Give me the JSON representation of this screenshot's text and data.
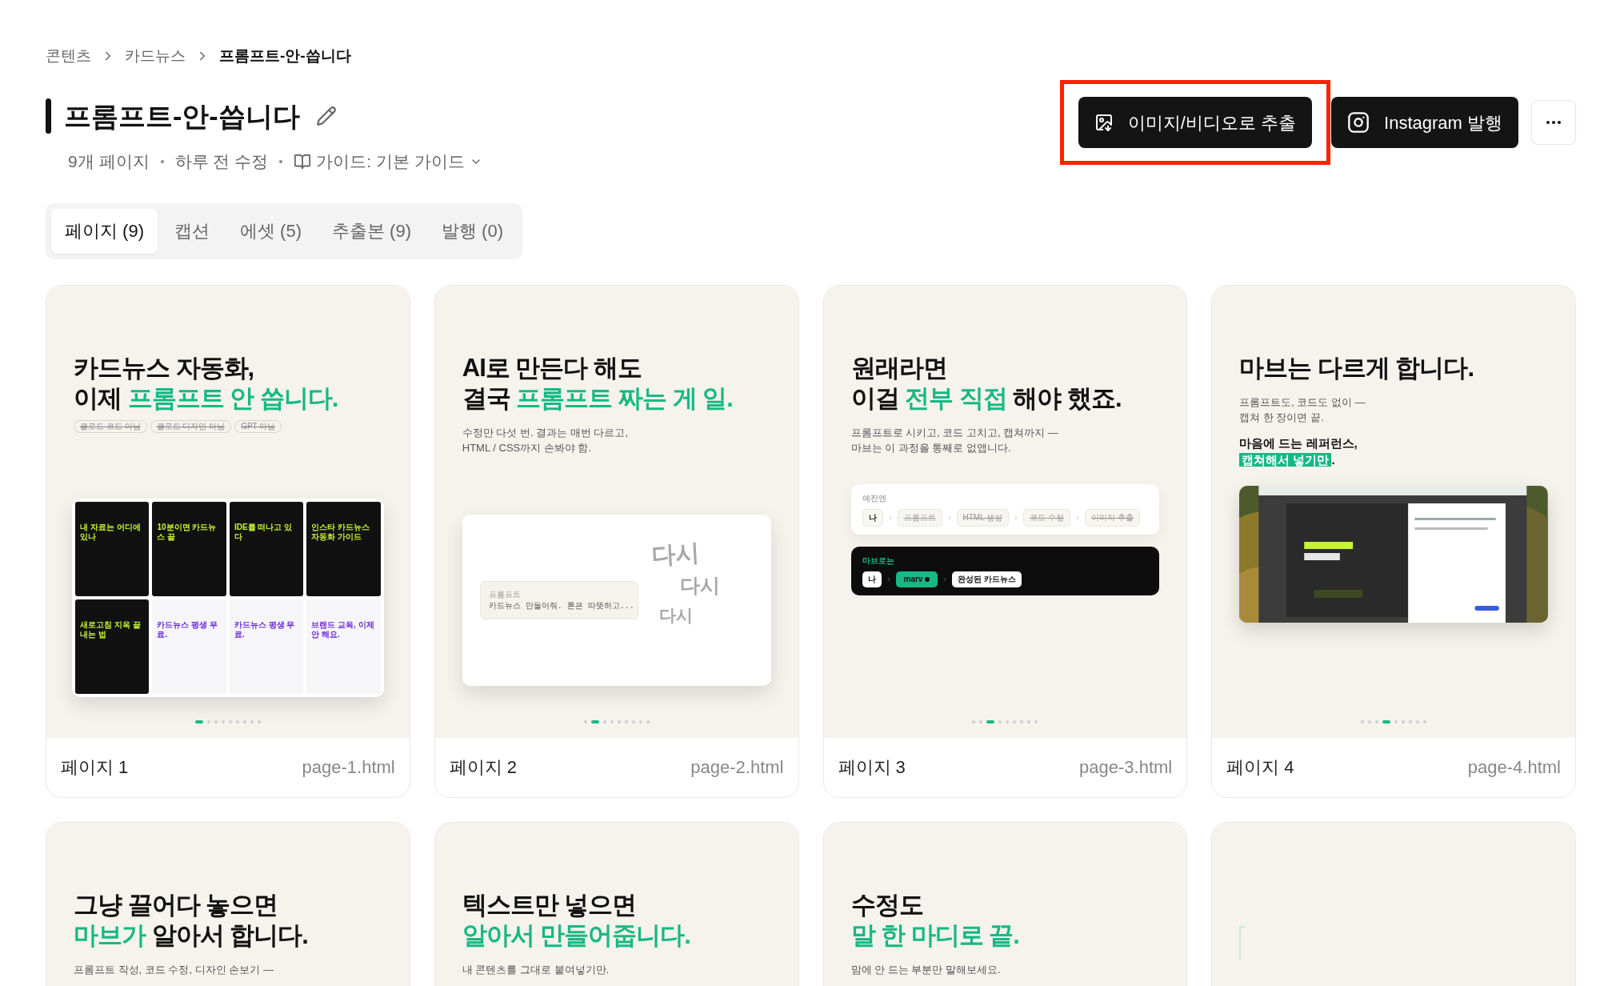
{
  "breadcrumb": [
    {
      "label": "콘텐츠",
      "current": false
    },
    {
      "label": "카드뉴스",
      "current": false
    },
    {
      "label": "프롬프트-안-씁니다",
      "current": true
    }
  ],
  "title": "프롬프트-안-씁니다",
  "meta": {
    "pages": "9개 페이지",
    "updated": "하루 전 수정",
    "guide": "가이드: 기본 가이드"
  },
  "actions": [
    {
      "kind": "export",
      "label": "이미지/비디오로 추출",
      "highlighted": true
    },
    {
      "kind": "instagram",
      "label": "Instagram 발행",
      "highlighted": false
    }
  ],
  "tabs": [
    {
      "label": "페이지 (9)",
      "selected": true
    },
    {
      "label": "캡션",
      "selected": false
    },
    {
      "label": "에셋 (5)",
      "selected": false
    },
    {
      "label": "추출본 (9)",
      "selected": false
    },
    {
      "label": "발행 (0)",
      "selected": false
    }
  ],
  "cards": [
    {
      "kind": "tiles",
      "name": "페이지 1",
      "file": "page-1.html",
      "heading": [
        [
          {
            "text": "카드뉴스 자동화,",
            "accent": false
          }
        ],
        [
          {
            "text": "이제 ",
            "accent": false
          },
          {
            "text": "프롬프트 안 씁니다.",
            "accent": true
          }
        ]
      ],
      "chips": [
        "클로드 코드 아님",
        "클로드 디자인 아님",
        "GPT 아님"
      ],
      "tiles": [
        {
          "dark": true,
          "title": "내 자료는 어디에 있나"
        },
        {
          "dark": true,
          "title": "10분이면 카드뉴스 끝"
        },
        {
          "dark": true,
          "title": "IDE를 떠나고 있다"
        },
        {
          "dark": true,
          "title": "인스타 카드뉴스 자동화 가이드"
        },
        {
          "dark": true,
          "title": "새로고침 지옥 끝내는 법"
        },
        {
          "dark": false,
          "title": "카드뉴스 평생 무료."
        },
        {
          "dark": false,
          "title": "카드뉴스 평생 무료."
        },
        {
          "dark": false,
          "title": "브랜드 교육, 이제 안 해요."
        }
      ],
      "dots": [
        true,
        false,
        false,
        false,
        false,
        false,
        false,
        false,
        false
      ]
    },
    {
      "kind": "prompt",
      "name": "페이지 2",
      "file": "page-2.html",
      "heading": [
        [
          {
            "text": "AI로 만든다 해도",
            "accent": false
          }
        ],
        [
          {
            "text": "결국 ",
            "accent": false
          },
          {
            "text": "프롬프트 짜는 게 일.",
            "accent": true
          }
        ]
      ],
      "sub": [
        "수정만 다섯 번. 결과는 매번 다르고,",
        "HTML / CSS까지 손봐야 함."
      ],
      "prompt": {
        "label": "프롬프트",
        "value": "카드뉴스 만들어줘. 톤은 따뜻하고..."
      },
      "retry": [
        "다시",
        "다시",
        "다시"
      ],
      "dots": [
        false,
        true,
        false,
        false,
        false,
        false,
        false,
        false,
        false
      ]
    },
    {
      "kind": "flow",
      "name": "페이지 3",
      "file": "page-3.html",
      "heading": [
        [
          {
            "text": "원래라면",
            "accent": false
          }
        ],
        [
          {
            "text": "이걸 ",
            "accent": false
          },
          {
            "text": "전부 직접",
            "accent": true
          },
          {
            "text": " 해야 했죠.",
            "accent": false
          }
        ]
      ],
      "sub": [
        "프롬프트로 시키고, 코드 고치고, 캡쳐까지 —",
        "마브는 이 과정을 통째로 없앱니다."
      ],
      "before": {
        "label": "예전엔",
        "steps": [
          {
            "label": "나",
            "struck": false
          },
          {
            "label": "프롬프트",
            "struck": true
          },
          {
            "label": "HTML 생성",
            "struck": true
          },
          {
            "label": "코드 수정",
            "struck": true
          },
          {
            "label": "이미지 추출",
            "struck": true
          }
        ]
      },
      "after": {
        "label": "마브로는",
        "steps": [
          {
            "label": "나",
            "kind": "plain"
          },
          {
            "label": "marv",
            "kind": "brand"
          },
          {
            "label": "완성된 카드뉴스",
            "kind": "plain"
          }
        ]
      },
      "dots": [
        false,
        false,
        true,
        false,
        false,
        false,
        false,
        false,
        false
      ]
    },
    {
      "kind": "capture",
      "name": "페이지 4",
      "file": "page-4.html",
      "heading": [
        [
          {
            "text": "마브는 다르게 합니다.",
            "accent": false
          }
        ]
      ],
      "sub": [
        "프롬프트도, 코드도 없이 —",
        "캡쳐 한 장이면 끝."
      ],
      "emphasis": {
        "line": "마음에 드는 레퍼런스,",
        "mark": "캡쳐해서 넣기만",
        "tail": "."
      },
      "dots": [
        false,
        false,
        false,
        true,
        false,
        false,
        false,
        false,
        false
      ]
    },
    {
      "kind": "text",
      "heading": [
        [
          {
            "text": "그냥 끌어다 놓으면",
            "accent": false
          }
        ],
        [
          {
            "text": "마브가",
            "accent": true
          },
          {
            "text": " 알아서 합니다.",
            "accent": false
          }
        ]
      ],
      "sub": [
        "프롬프트 작성, 코드 수정, 디자인 손보기 —"
      ]
    },
    {
      "kind": "text",
      "heading": [
        [
          {
            "text": "텍스트만 넣으면",
            "accent": false
          }
        ],
        [
          {
            "text": "알아서 만들어줍니다.",
            "accent": true
          }
        ]
      ],
      "sub": [
        "내 콘텐츠를 그대로 붙여넣기만."
      ]
    },
    {
      "kind": "text",
      "heading": [
        [
          {
            "text": "수정도",
            "accent": false
          }
        ],
        [
          {
            "text": "말 한 마디로 끝.",
            "accent": true
          }
        ]
      ],
      "sub": [
        "맘에 안 드는 부분만 말해보세요."
      ]
    },
    {
      "kind": "blank"
    }
  ]
}
